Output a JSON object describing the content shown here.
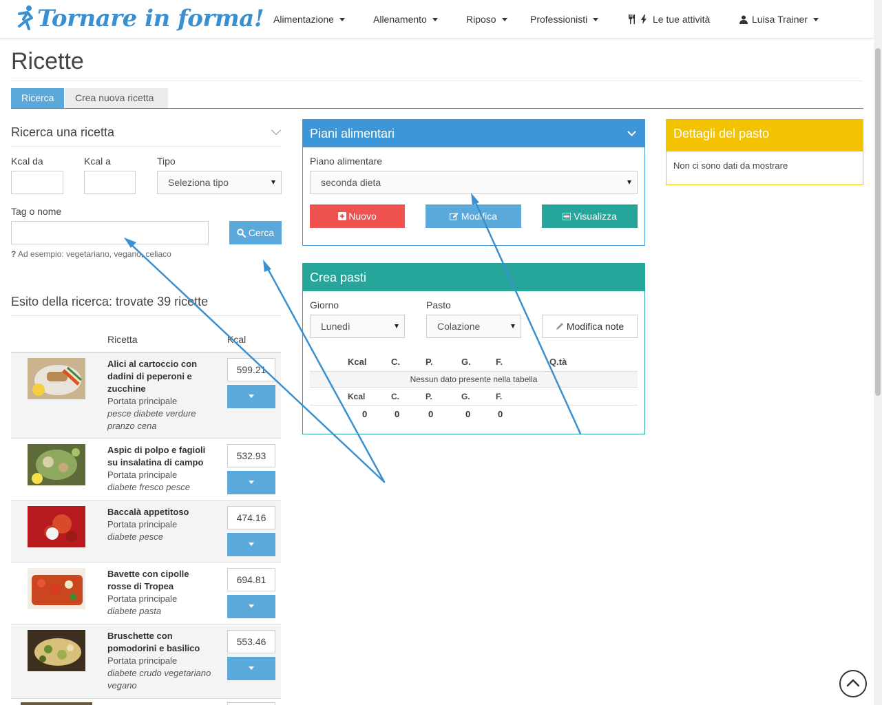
{
  "brand": {
    "name": "Tornare in forma!"
  },
  "nav": {
    "items": [
      {
        "label": "Alimentazione"
      },
      {
        "label": "Allenamento"
      },
      {
        "label": "Riposo"
      },
      {
        "label": "Professionisti"
      },
      {
        "label": "Le tue attività"
      },
      {
        "label": "Luisa Trainer"
      }
    ]
  },
  "page": {
    "title": "Ricette"
  },
  "tabs": [
    {
      "label": "Ricerca"
    },
    {
      "label": "Crea nuova ricetta"
    }
  ],
  "search": {
    "heading": "Ricerca una ricetta",
    "kcal_from_label": "Kcal da",
    "kcal_to_label": "Kcal a",
    "type_label": "Tipo",
    "type_value": "Seleziona tipo",
    "tag_label": "Tag o nome",
    "search_button": "Cerca",
    "hint_mark": "?",
    "hint": "Ad esempio: vegetariano, vegano, celiaco"
  },
  "results": {
    "heading": "Esito della ricerca: trovate 39 ricette",
    "col_recipe": "Ricetta",
    "col_kcal": "Kcal",
    "rows": [
      {
        "name": "Alici al cartoccio con dadini di peperoni e zucchine",
        "category": "Portata principale",
        "tags": "pesce diabete verdure pranzo cena",
        "kcal": "599.21"
      },
      {
        "name": "Aspic di polpo e fagioli su insalatina di campo",
        "category": "Portata principale",
        "tags": "diabete fresco pesce",
        "kcal": "532.93"
      },
      {
        "name": "Baccalà appetitoso",
        "category": "Portata principale",
        "tags": "diabete pesce",
        "kcal": "474.16"
      },
      {
        "name": "Bavette con cipolle rosse di Tropea",
        "category": "Portata principale",
        "tags": "diabete pasta",
        "kcal": "694.81"
      },
      {
        "name": "Bruschette con pomodorini e basilico",
        "category": "Portata principale",
        "tags": "diabete crudo vegetariano vegano",
        "kcal": "553.46"
      }
    ]
  },
  "meal_plans": {
    "title": "Piani alimentari",
    "plan_label": "Piano alimentare",
    "plan_value": "seconda dieta",
    "btn_new": "Nuovo",
    "btn_edit": "Modifica",
    "btn_view": "Visualizza"
  },
  "create_meals": {
    "title": "Crea pasti",
    "day_label": "Giorno",
    "day_value": "Lunedì",
    "meal_label": "Pasto",
    "meal_value": "Colazione",
    "notes_button": "Modifica note",
    "columns": [
      "Kcal",
      "C.",
      "P.",
      "G.",
      "F.",
      "Q.tà"
    ],
    "empty_message": "Nessun dato presente nella tabella",
    "totals_columns": [
      "Kcal",
      "C.",
      "P.",
      "G.",
      "F."
    ],
    "totals_values": [
      "0",
      "0",
      "0",
      "0",
      "0"
    ]
  },
  "meal_details": {
    "title": "Dettagli del pasto",
    "empty": "Non ci sono dati da mostrare"
  },
  "colors": {
    "primary": "#3a8fd0",
    "light_blue": "#5ba8db",
    "danger": "#ef5350",
    "teal": "#26a69a",
    "panel_blue": "#3d96d8",
    "yellow": "#f3c200"
  },
  "icons": [
    "cutlery-icon",
    "bolt-icon",
    "user-icon",
    "search-icon",
    "plus-square-icon",
    "edit-icon",
    "list-icon",
    "pencil-icon",
    "chevron-up-icon"
  ]
}
